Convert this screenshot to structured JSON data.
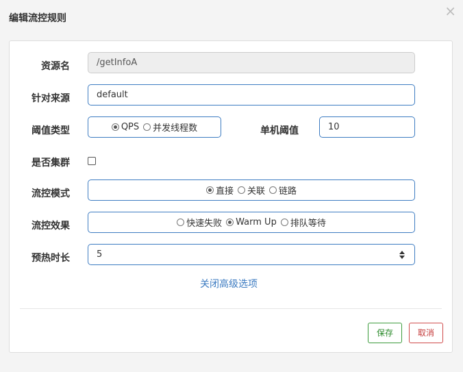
{
  "dialog": {
    "title": "编辑流控规则",
    "close_glyph": "×"
  },
  "form": {
    "resource": {
      "label": "资源名",
      "value": "/getInfoA"
    },
    "limit_app": {
      "label": "针对来源",
      "value": "default"
    },
    "grade": {
      "label": "阈值类型",
      "options": [
        "QPS",
        "并发线程数"
      ],
      "selected": "QPS"
    },
    "threshold": {
      "label": "单机阈值",
      "value": "10"
    },
    "cluster": {
      "label": "是否集群",
      "checked": false
    },
    "strategy": {
      "label": "流控模式",
      "options": [
        "直接",
        "关联",
        "链路"
      ],
      "selected": "直接"
    },
    "control_behavior": {
      "label": "流控效果",
      "options": [
        "快速失败",
        "Warm Up",
        "排队等待"
      ],
      "selected": "Warm Up"
    },
    "warmup": {
      "label": "预热时长",
      "value": "5"
    },
    "advanced_link": "关闭高级选项"
  },
  "footer": {
    "save_label": "保存",
    "cancel_label": "取消"
  },
  "colors": {
    "accent": "#3c7bc1",
    "save": "#2b8a2b",
    "cancel": "#c43a3a"
  }
}
